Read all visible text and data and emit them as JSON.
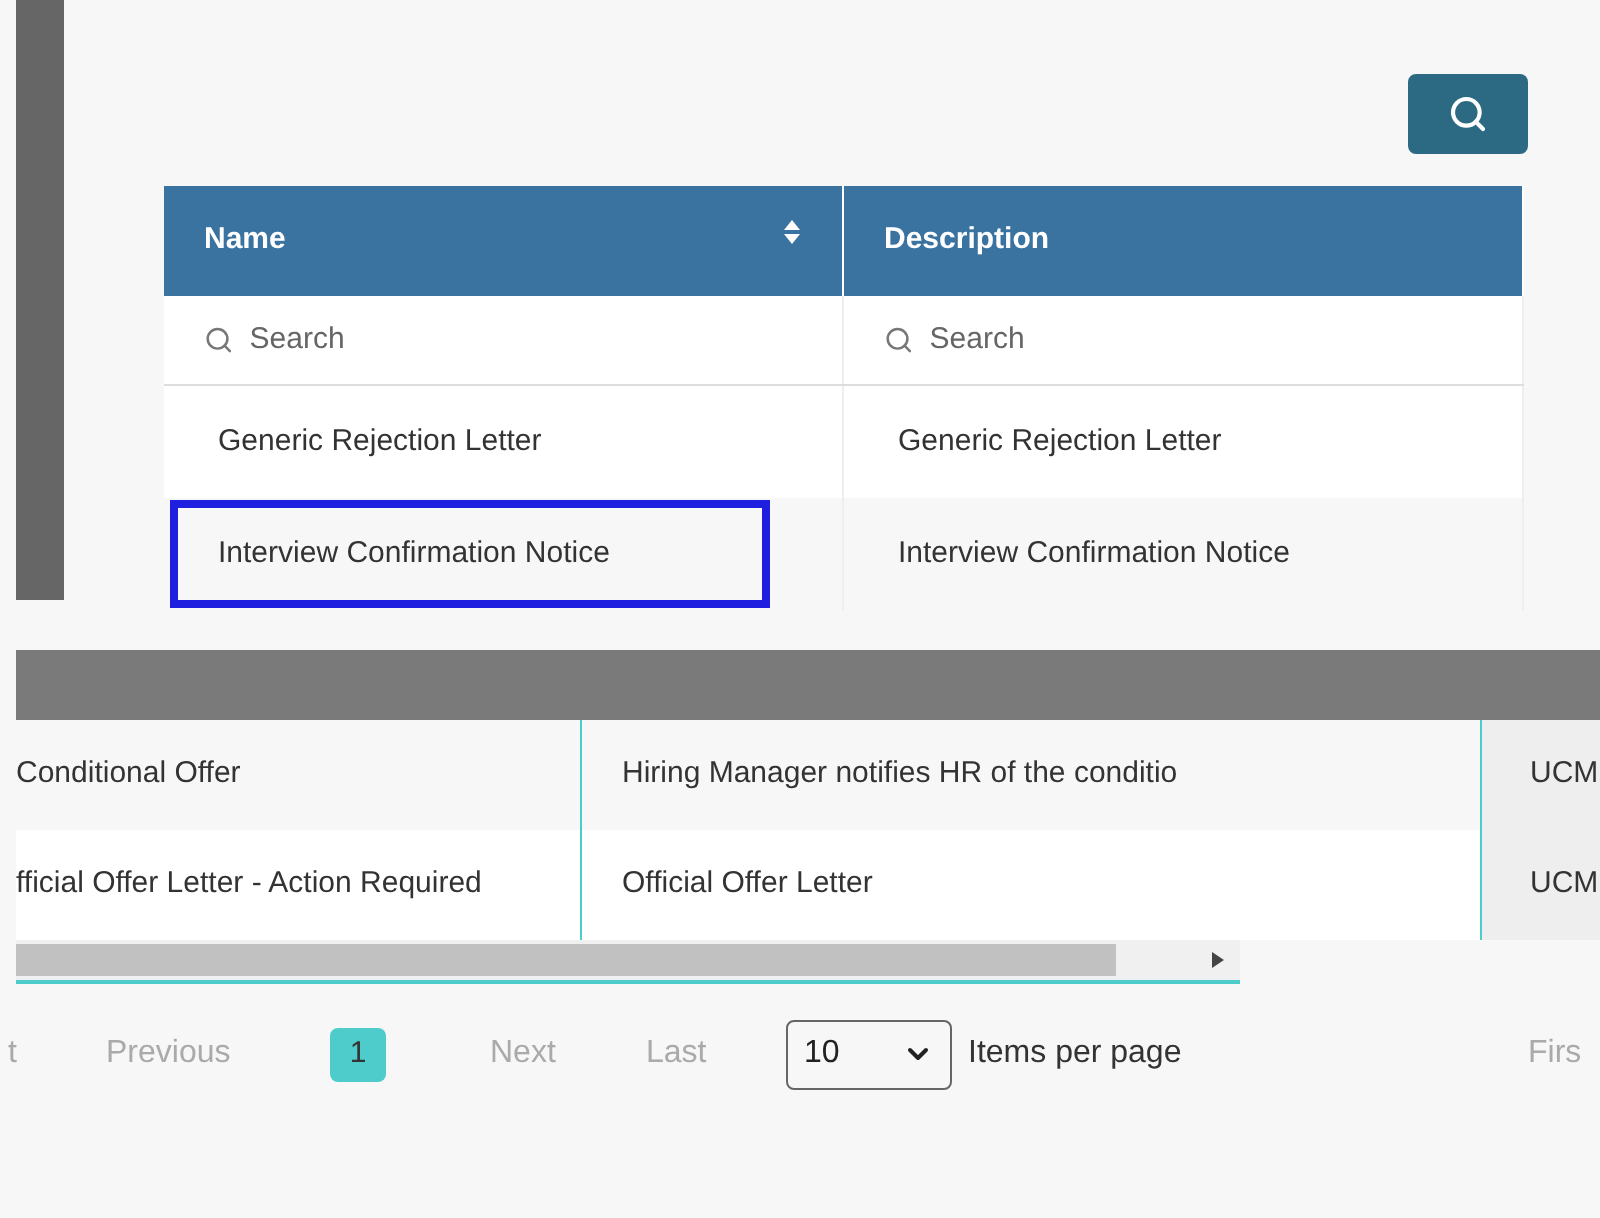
{
  "top_table": {
    "columns": [
      {
        "label": "Name",
        "sortable": true
      },
      {
        "label": "Description",
        "sortable": false
      }
    ],
    "search_placeholders": [
      "Search",
      "Search"
    ],
    "rows": [
      {
        "cells": [
          "Generic Rejection Letter",
          "Generic Rejection Letter"
        ],
        "selected": false
      },
      {
        "cells": [
          "Interview Confirmation Notice",
          "Interview Confirmation Notice"
        ],
        "selected": true
      }
    ]
  },
  "lower_table": {
    "rows": [
      {
        "cells": [
          "Conditional Offer",
          "Hiring Manager notifies HR of the conditio",
          "UCM"
        ]
      },
      {
        "cells": [
          "fficial Offer Letter - Action Required",
          "Official Offer Letter",
          "UCM"
        ]
      }
    ]
  },
  "pagination": {
    "first": "t",
    "previous": "Previous",
    "pages": [
      {
        "label": "1",
        "selected": true
      }
    ],
    "next": "Next",
    "last": "Last",
    "page_size": "10",
    "page_size_label": "Items per page",
    "first_right": "Firs"
  }
}
